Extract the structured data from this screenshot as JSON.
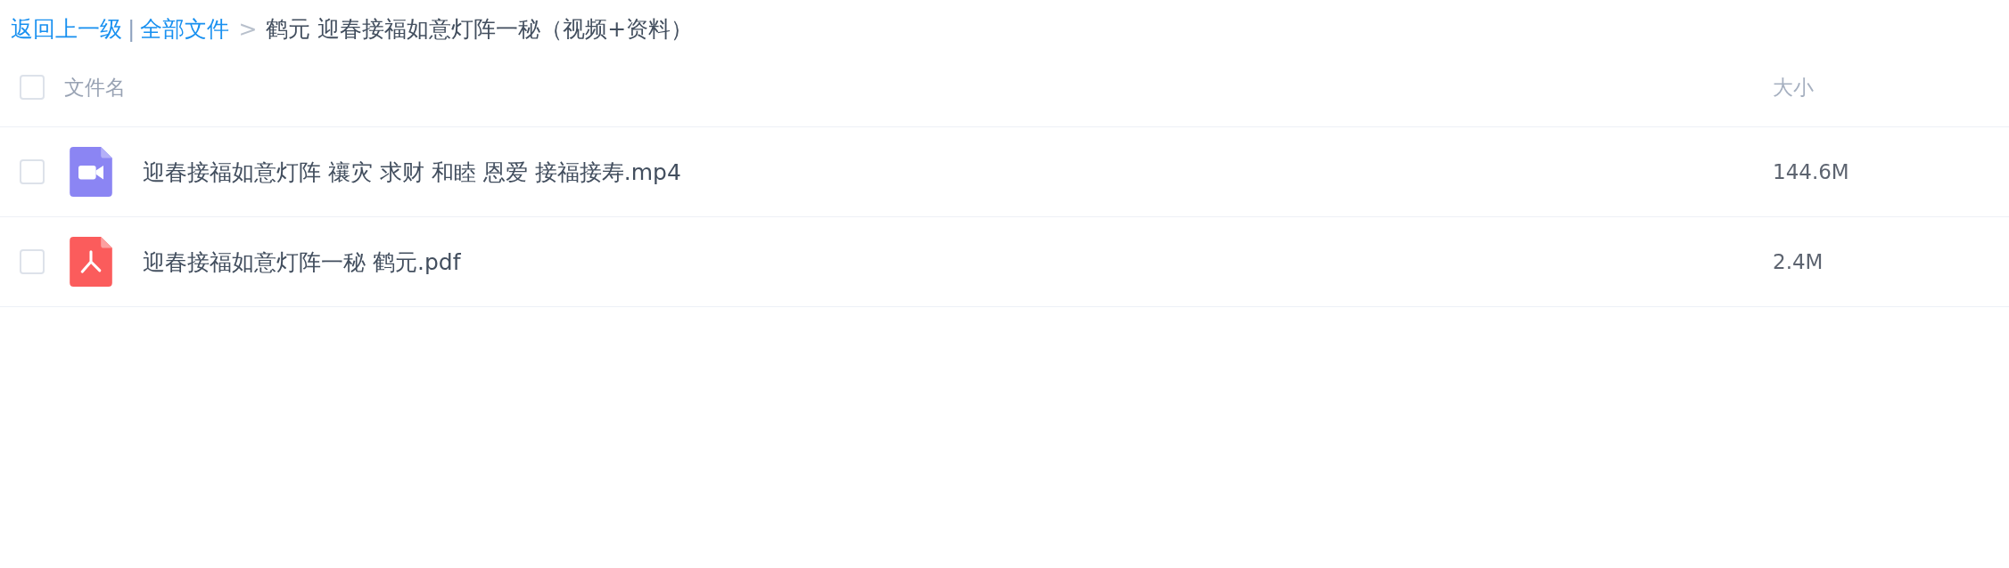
{
  "breadcrumb": {
    "back": "返回上一级",
    "separator": "|",
    "root": "全部文件",
    "arrow": ">",
    "current": "鹤元 迎春接福如意灯阵一秘（视频+资料）"
  },
  "table": {
    "select_all_checked": false,
    "columns": [
      "文件名",
      "大小"
    ],
    "rows": [
      {
        "kind": "video",
        "name": "迎春接福如意灯阵 禳灾 求财 和睦 恩爱 接福接寿.mp4",
        "size": "144.6M",
        "checked": false
      },
      {
        "kind": "pdf",
        "name": "迎春接福如意灯阵一秘 鹤元.pdf",
        "size": "2.4M",
        "checked": false
      }
    ]
  }
}
